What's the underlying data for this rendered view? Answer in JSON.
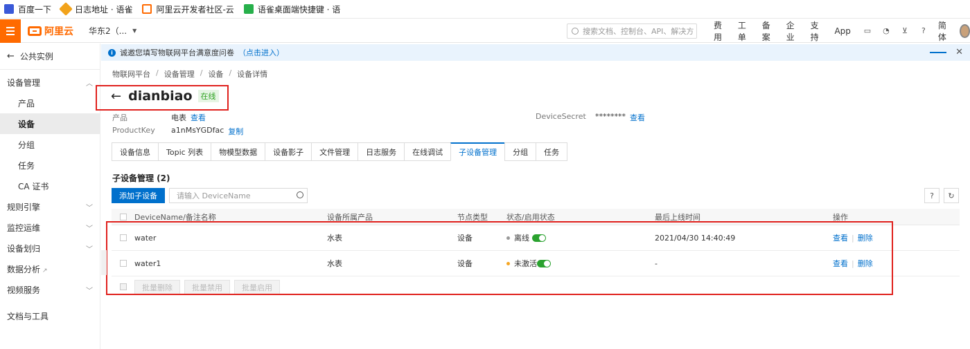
{
  "bookmarks": [
    {
      "label": "百度一下",
      "icon": "baidu-icon"
    },
    {
      "label": "日志地址 · 语雀",
      "icon": "flame-icon"
    },
    {
      "label": "阿里云开发者社区-云",
      "icon": "aliyun-icon"
    },
    {
      "label": "语雀桌面端快捷键 · 语",
      "icon": "leaf-icon"
    }
  ],
  "topnav": {
    "logo": "阿里云",
    "region": "华东2（...",
    "search_placeholder": "搜索文档、控制台、API、解决方",
    "menu": [
      "费用",
      "工单",
      "备案",
      "企业",
      "支持",
      "App"
    ],
    "lang": "简体"
  },
  "sidebar": {
    "back_label": "公共实例",
    "groups": [
      {
        "label": "设备管理",
        "items": [
          "产品",
          "设备",
          "分组",
          "任务",
          "CA 证书"
        ],
        "active": "设备"
      },
      {
        "label": "规则引擎"
      },
      {
        "label": "监控运维"
      },
      {
        "label": "设备划归"
      },
      {
        "label": "数据分析"
      },
      {
        "label": "视频服务"
      }
    ],
    "bottom": "文档与工具"
  },
  "notice": {
    "text": "诚邀您填写物联网平台满意度问卷",
    "link": "（点击进入）"
  },
  "breadcrumb": [
    "物联网平台",
    "设备管理",
    "设备",
    "设备详情"
  ],
  "device": {
    "name": "dianbiao",
    "status": "在线",
    "product_label": "产品",
    "product_value": "电表",
    "product_link": "查看",
    "productkey_label": "ProductKey",
    "productkey_value": "a1nMsYGDfac",
    "productkey_link": "复制",
    "secret_label": "DeviceSecret",
    "secret_value": "********",
    "secret_link": "查看"
  },
  "tabs": [
    "设备信息",
    "Topic 列表",
    "物模型数据",
    "设备影子",
    "文件管理",
    "日志服务",
    "在线调试",
    "子设备管理",
    "分组",
    "任务"
  ],
  "active_tab": "子设备管理",
  "subdevices": {
    "title": "子设备管理 (2)",
    "add_button": "添加子设备",
    "filter_placeholder": "请输入 DeviceName",
    "columns": [
      "DeviceName/备注名称",
      "设备所属产品",
      "节点类型",
      "状态/启用状态",
      "最后上线时间",
      "操作"
    ],
    "rows": [
      {
        "name": "water",
        "product": "水表",
        "node": "设备",
        "status": "离线",
        "status_color": "#999999",
        "last_online": "2021/04/30 14:40:49",
        "op_view": "查看",
        "op_delete": "删除"
      },
      {
        "name": "water1",
        "product": "水表",
        "node": "设备",
        "status": "未激活",
        "status_color": "#f5a623",
        "last_online": "-",
        "op_view": "查看",
        "op_delete": "删除"
      }
    ],
    "batch_buttons": [
      "批量删除",
      "批量禁用",
      "批量启用"
    ]
  }
}
